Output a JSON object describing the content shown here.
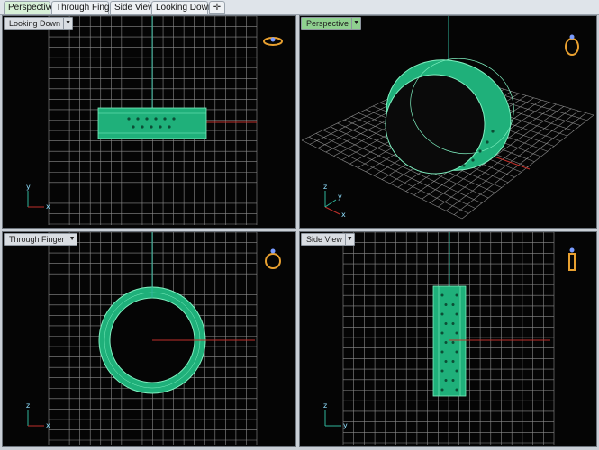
{
  "tabs": [
    {
      "label": "Perspective",
      "active": true
    },
    {
      "label": "Through Finger",
      "active": false
    },
    {
      "label": "Side View",
      "active": false
    },
    {
      "label": "Looking Down",
      "active": false
    }
  ],
  "add_tab_icon": "plus-icon",
  "viewports": {
    "top_left": {
      "label": "Looking Down",
      "active": false,
      "widget": "ring-top-view-icon",
      "axes": {
        "vertical": "y",
        "horizontal": "x"
      }
    },
    "top_right": {
      "label": "Perspective",
      "active": true,
      "widget": "ring-perspective-icon",
      "axes": {
        "vertical": "z",
        "horizontal": "x",
        "depth": "y"
      }
    },
    "bottom_left": {
      "label": "Through Finger",
      "active": false,
      "widget": "ring-front-view-icon",
      "axes": {
        "vertical": "z",
        "horizontal": "x"
      }
    },
    "bottom_right": {
      "label": "Side View",
      "active": false,
      "widget": "ring-side-view-icon",
      "axes": {
        "vertical": "z",
        "horizontal": "y"
      }
    }
  },
  "colors": {
    "grid": "#9a9a9a",
    "grid_major": "#bdbdbd",
    "axis_x": "#c0302a",
    "axis_y": "#2fb59a",
    "ring": "#1fb07a",
    "ring_edge": "#7ff0c0",
    "active_tab": "#d7f0d7",
    "active_label": "#8fd18f"
  }
}
